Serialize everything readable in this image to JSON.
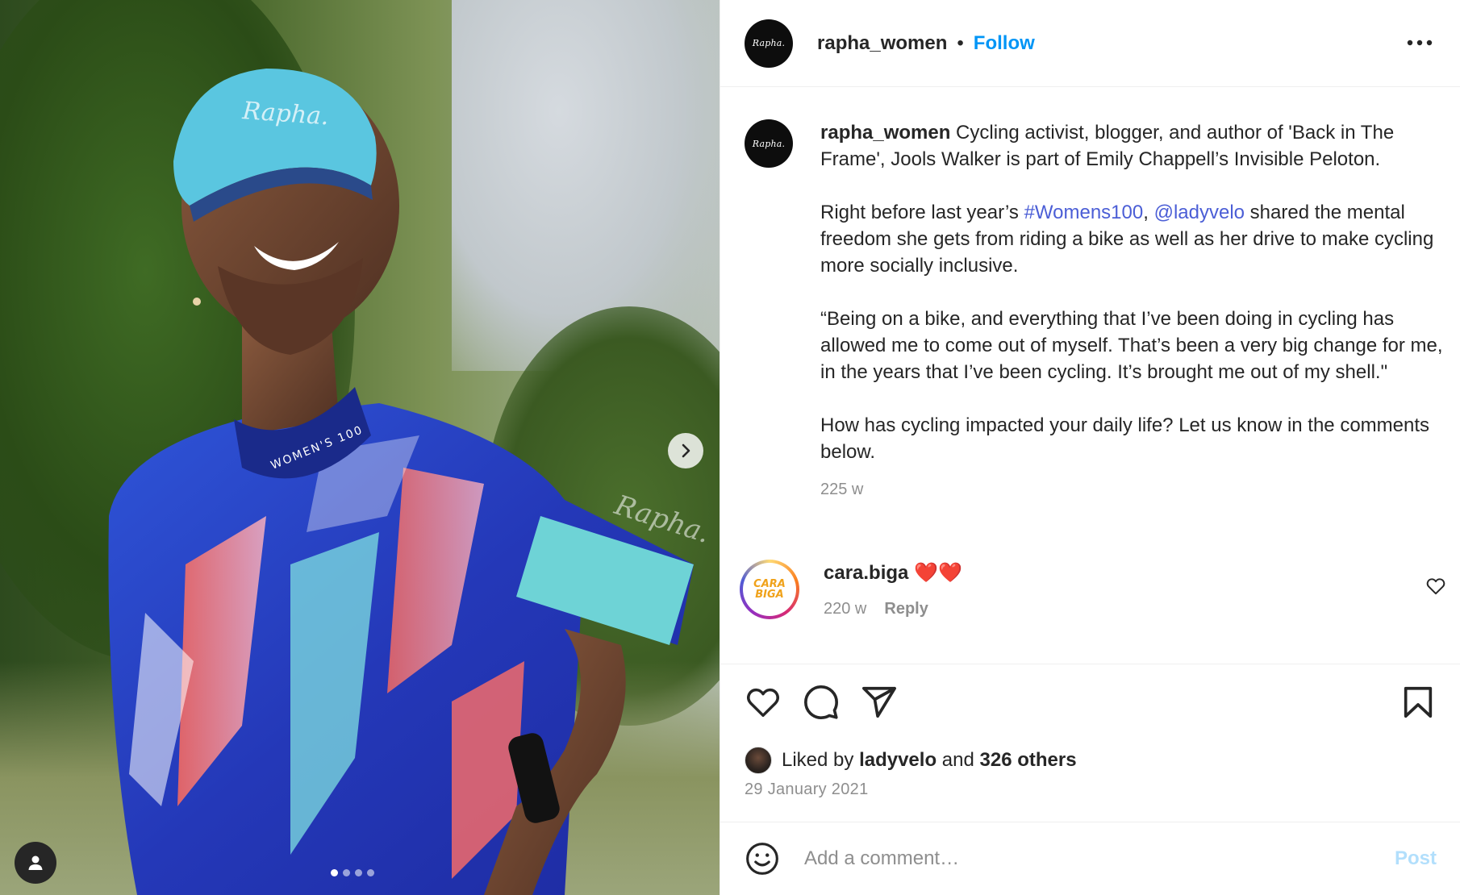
{
  "post": {
    "author": "rapha_women",
    "avatar_text": "Rapha.",
    "follow_label": "Follow",
    "separator": "•",
    "caption_paragraphs": [
      [
        {
          "text": "rapha_women",
          "kind": "uname"
        },
        {
          "text": " Cycling activist, blogger, and author of 'Back in The Frame', Jools Walker is part of Emily Chappell’s Invisible Peloton.",
          "kind": "text"
        }
      ],
      [
        {
          "text": "Right before last year’s ",
          "kind": "text"
        },
        {
          "text": "#Womens100",
          "kind": "link"
        },
        {
          "text": ", ",
          "kind": "text"
        },
        {
          "text": "@ladyvelo",
          "kind": "link"
        },
        {
          "text": " shared the mental freedom she gets from riding a bike as well as her drive to make cycling more socially inclusive.",
          "kind": "text"
        }
      ],
      [
        {
          "text": "“Being on a bike, and everything that I’ve been doing in cycling has allowed me to come out of myself. That’s been a very big change for me, in the years that I’ve been cycling. It’s brought me out of my shell.\"",
          "kind": "text"
        }
      ],
      [
        {
          "text": "How has cycling impacted your daily life? Let us know in the comments below.",
          "kind": "text"
        }
      ]
    ],
    "caption_age": "225 w",
    "carousel": {
      "slide_count": 4,
      "active_index": 0
    }
  },
  "photo": {
    "cap_brand": "Rapha.",
    "collar_text": "WOMEN'S 100",
    "sleeve_brand": "Rapha."
  },
  "comments": [
    {
      "username": "cara.biga",
      "text": "❤️❤️",
      "avatar_text_line1": "CARA",
      "avatar_text_line2": "BIGA",
      "age": "220 w",
      "reply_label": "Reply"
    }
  ],
  "engagement": {
    "liked_by_prefix": "Liked by",
    "liked_by_user": "ladyvelo",
    "and_label": "and",
    "others_label": "326 others",
    "date": "29 January 2021"
  },
  "composer": {
    "placeholder": "Add a comment…",
    "post_label": "Post"
  },
  "icons": {
    "more": "more-horizontal-icon",
    "like": "heart-icon",
    "comment": "comment-bubble-icon",
    "share": "paper-plane-icon",
    "save": "bookmark-icon",
    "emoji": "smiley-icon",
    "next": "chevron-right-icon",
    "tag": "user-tag-icon"
  },
  "colors": {
    "link": "#4b5ed6",
    "follow": "#0095f6",
    "post_disabled": "#b2dffc",
    "secondary_text": "#8e8e8e"
  }
}
